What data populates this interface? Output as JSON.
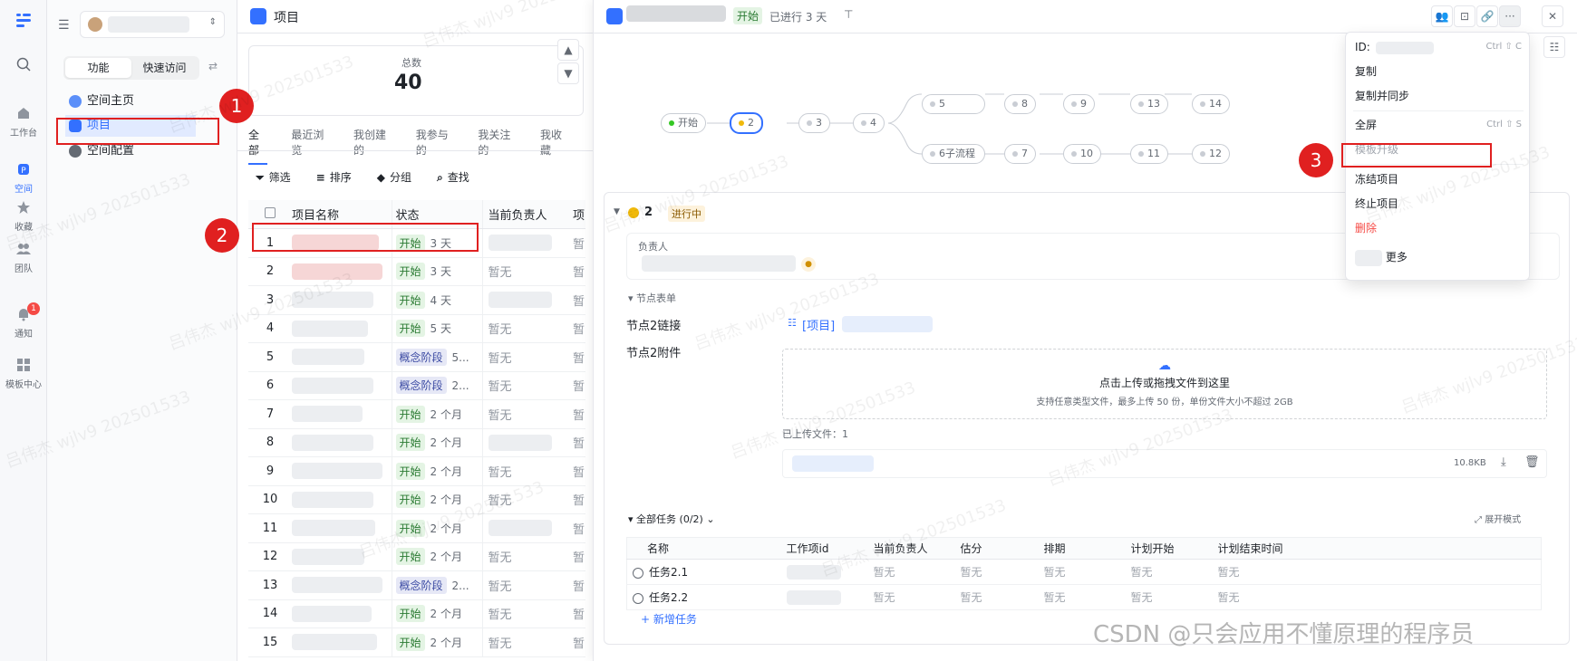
{
  "rail": {
    "items": [
      {
        "label": "",
        "icon": "search-icon"
      },
      {
        "label": "工作台",
        "icon": "home-icon"
      },
      {
        "label": "空间",
        "icon": "space-icon"
      },
      {
        "label": "收藏",
        "icon": "star-icon"
      },
      {
        "label": "团队",
        "icon": "team-icon"
      },
      {
        "label": "通知",
        "icon": "bell-icon",
        "badge": "1"
      },
      {
        "label": "模板中心",
        "icon": "template-icon"
      }
    ]
  },
  "sidebar": {
    "seg_left": "功能",
    "seg_right": "快速访问",
    "items": [
      {
        "label": "空间主页",
        "color": "#5b8ff9"
      },
      {
        "label": "项目",
        "color": "#3370ff"
      },
      {
        "label": "空间配置",
        "color": "#646a73"
      }
    ]
  },
  "list": {
    "title": "项目",
    "stat_label": "总数",
    "stat_value": "40",
    "tabs": [
      "全部",
      "最近浏览",
      "我创建的",
      "我参与的",
      "我关注的",
      "我收藏"
    ],
    "tools": [
      "筛选",
      "排序",
      "分组",
      "查找"
    ],
    "headers": [
      "项目名称",
      "状态",
      "当前负责人",
      "项"
    ],
    "rows": [
      {
        "n": "1",
        "status": "开始",
        "dur": "3 天",
        "owner": "",
        "x": "暂"
      },
      {
        "n": "2",
        "status": "开始",
        "dur": "3 天",
        "owner": "暂无",
        "x": "暂"
      },
      {
        "n": "3",
        "status": "开始",
        "dur": "4 天",
        "owner": "",
        "x": "暂"
      },
      {
        "n": "4",
        "status": "开始",
        "dur": "5 天",
        "owner": "暂无",
        "x": "暂"
      },
      {
        "n": "5",
        "status": "概念阶段",
        "dur": "5...",
        "owner": "暂无",
        "x": "暂"
      },
      {
        "n": "6",
        "status": "概念阶段",
        "dur": "2...",
        "owner": "暂无",
        "x": "暂"
      },
      {
        "n": "7",
        "status": "开始",
        "dur": "2 个月",
        "owner": "暂无",
        "x": "暂"
      },
      {
        "n": "8",
        "status": "开始",
        "dur": "2 个月",
        "owner": "",
        "x": "暂"
      },
      {
        "n": "9",
        "status": "开始",
        "dur": "2 个月",
        "owner": "暂无",
        "x": "暂"
      },
      {
        "n": "10",
        "status": "开始",
        "dur": "2 个月",
        "owner": "暂无",
        "x": "暂"
      },
      {
        "n": "11",
        "status": "开始",
        "dur": "2 个月",
        "owner": "",
        "x": "暂"
      },
      {
        "n": "12",
        "status": "开始",
        "dur": "2 个月",
        "owner": "暂无",
        "x": "暂"
      },
      {
        "n": "13",
        "status": "概念阶段",
        "dur": "2...",
        "owner": "暂无",
        "x": "暂"
      },
      {
        "n": "14",
        "status": "开始",
        "dur": "2 个月",
        "owner": "暂无",
        "x": "暂"
      },
      {
        "n": "15",
        "status": "开始",
        "dur": "2 个月",
        "owner": "暂无",
        "x": "暂"
      }
    ]
  },
  "detail": {
    "status": "开始",
    "elapsed": "已进行 3 天",
    "nodes": [
      "开始",
      "2",
      "3",
      "4",
      "5",
      "6子流程",
      "8",
      "7",
      "9",
      "10",
      "13",
      "11",
      "14",
      "12"
    ],
    "section_num": "2",
    "section_status": "进行中",
    "owner_label": "负责人",
    "form_title": "节点表单",
    "link_label": "节点2链接",
    "link_value": "[项目]",
    "attach_label": "节点2附件",
    "upload_title": "点击上传或拖拽文件到这里",
    "upload_hint": "支持任意类型文件，最多上传 50 份，单份文件大小不超过 2GB",
    "uploaded_label": "已上传文件：1",
    "file_size": "10.8KB",
    "tasks_title": "全部任务 (0/2)",
    "expand_mode": "展开模式",
    "task_headers": [
      "名称",
      "工作项id",
      "当前负责人",
      "估分",
      "排期",
      "计划开始",
      "计划结束时间"
    ],
    "tasks": [
      {
        "name": "任务2.1",
        "vals": [
          "暂无",
          "暂无",
          "暂无",
          "暂无",
          "暂无"
        ]
      },
      {
        "name": "任务2.2",
        "vals": [
          "暂无",
          "暂无",
          "暂无",
          "暂无",
          "暂无"
        ]
      }
    ],
    "add_task": "新增任务"
  },
  "menu": {
    "id_label": "ID:",
    "id_shortcut": "Ctrl ⇧ C",
    "copy": "复制",
    "copy_sync": "复制并同步",
    "fullscreen": "全屏",
    "fullscreen_shortcut": "Ctrl ⇧ S",
    "template_upgrade": "模板升级",
    "freeze": "冻结项目",
    "terminate": "终止项目",
    "delete": "删除",
    "more": "更多"
  },
  "annotations": [
    "1",
    "2",
    "3"
  ],
  "watermark": "吕伟杰 wjlv9 202501533",
  "credit": "CSDN @只会应用不懂原理的程序员"
}
